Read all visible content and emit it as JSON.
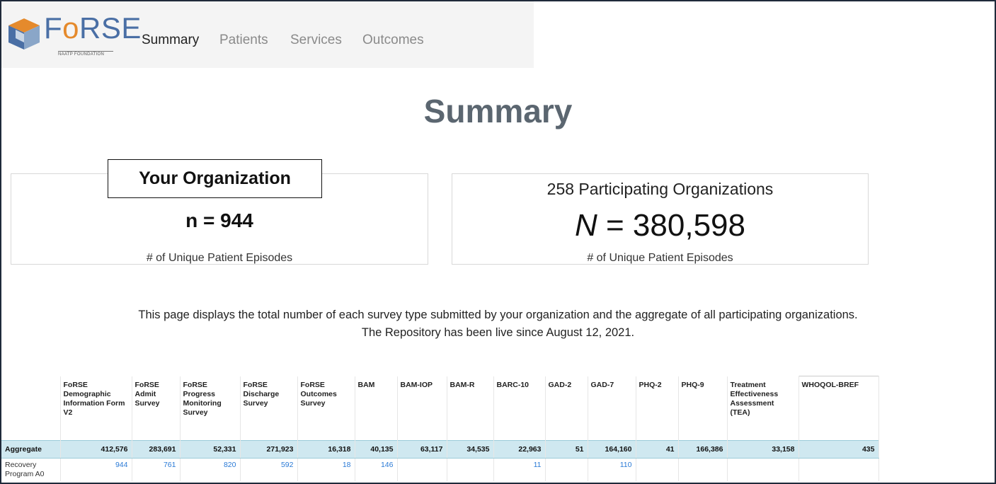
{
  "brand": {
    "logo_text": "FoRSE",
    "subtitle": "NAATP FOUNDATION"
  },
  "nav": {
    "items": [
      {
        "label": "Summary",
        "active": true
      },
      {
        "label": "Patients",
        "active": false
      },
      {
        "label": "Services",
        "active": false
      },
      {
        "label": "Outcomes",
        "active": false
      }
    ]
  },
  "page_title": "Summary",
  "your_org": {
    "label": "Your Organization",
    "count": "n = 944",
    "caption": "# of Unique Patient Episodes"
  },
  "all_orgs": {
    "title": "258 Participating Organizations",
    "count_symbol": "N",
    "count_value": "= 380,598",
    "caption": "# of Unique Patient Episodes"
  },
  "description": {
    "line1": "This page displays the total number of each survey type submitted by your organization and the aggregate of all participating organizations.",
    "line2": "The Repository has been live since August 12, 2021."
  },
  "table": {
    "columns": [
      "",
      "FoRSE Demographic Information Form V2",
      "FoRSE Admit Survey",
      "FoRSE Progress Monitoring Survey",
      "FoRSE Discharge Survey",
      "FoRSE Outcomes Survey",
      "BAM",
      "BAM-IOP",
      "BAM-R",
      "BARC-10",
      "GAD-2",
      "GAD-7",
      "PHQ-2",
      "PHQ-9",
      "Treatment Effectiveness Assessment (TEA)",
      "WHOQOL-BREF"
    ],
    "aggregate": [
      "Aggregate",
      "412,576",
      "283,691",
      "52,331",
      "271,923",
      "16,318",
      "40,135",
      "63,117",
      "34,535",
      "22,963",
      "51",
      "164,160",
      "41",
      "166,386",
      "33,158",
      "435"
    ],
    "org_row": [
      "Recovery Program A0",
      "944",
      "761",
      "820",
      "592",
      "18",
      "146",
      "",
      "",
      "11",
      "",
      "110",
      "",
      "",
      "",
      ""
    ]
  },
  "colors": {
    "accent_blue": "#2a7ad6",
    "aggregate_bg": "#cfe8f0",
    "title_gray": "#5b6670",
    "brand_blue": "#4a6fa5",
    "brand_orange": "#e58a2c"
  }
}
